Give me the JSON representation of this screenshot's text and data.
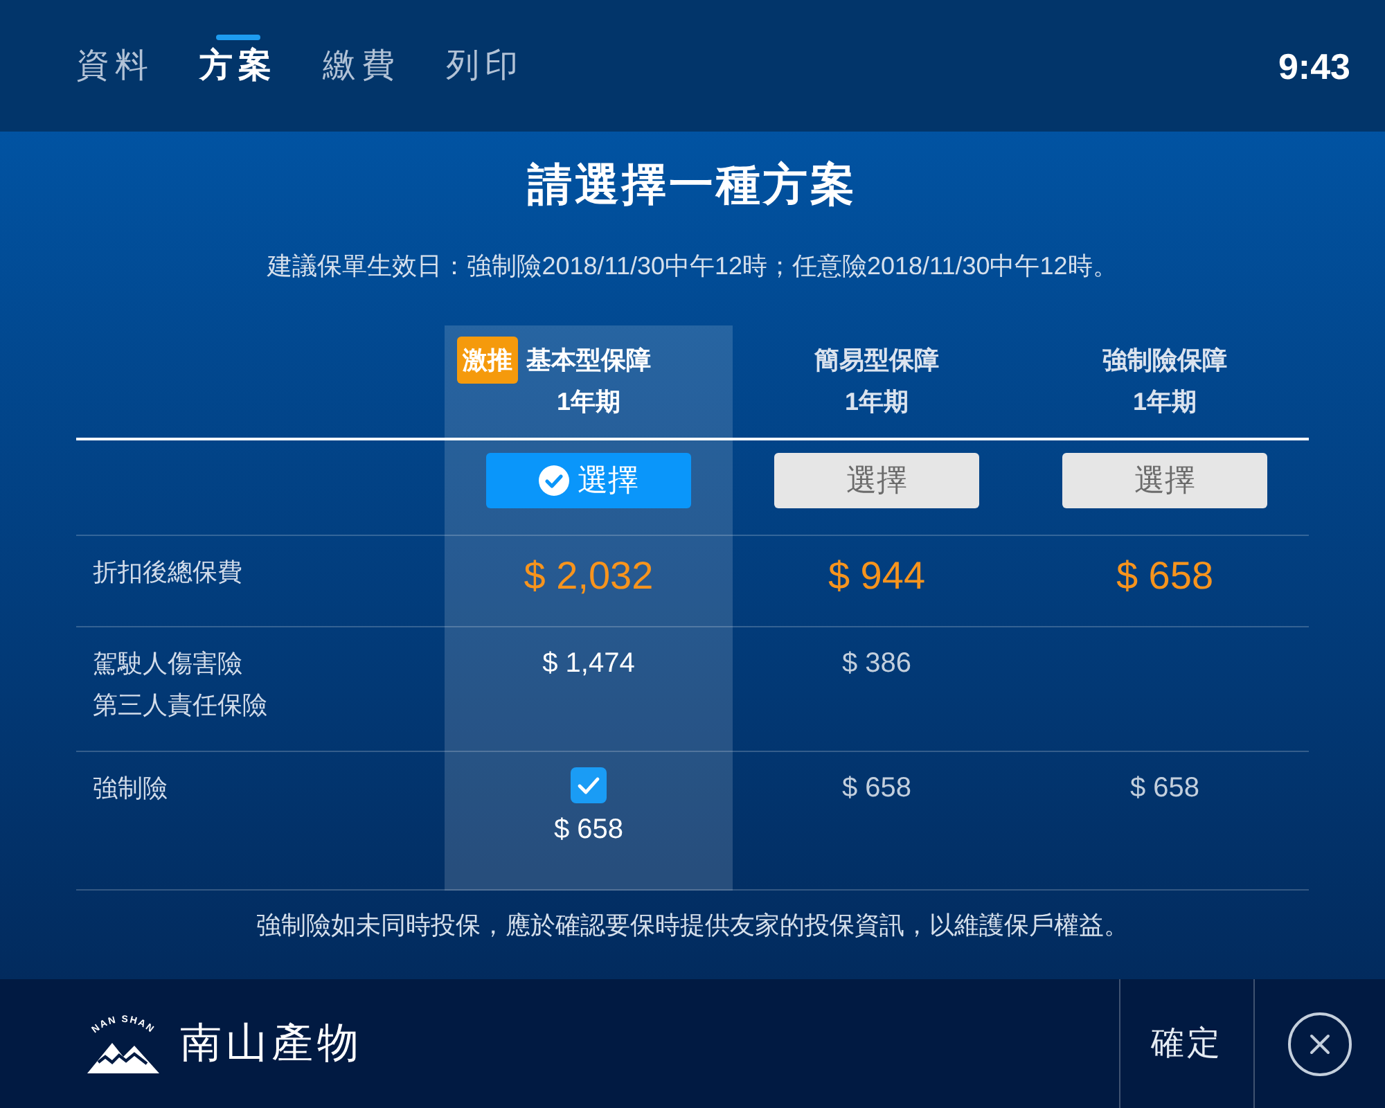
{
  "header": {
    "tabs": [
      {
        "label": "資料",
        "selected": false
      },
      {
        "label": "方案",
        "selected": true
      },
      {
        "label": "繳費",
        "selected": false
      },
      {
        "label": "列印",
        "selected": false
      }
    ],
    "time": "9:43"
  },
  "title": "請選擇一種方案",
  "subtitle": "建議保單生效日：強制險2018/11/30中午12時；任意險2018/11/30中午12時。",
  "plans": [
    {
      "badge": "激推",
      "name": "基本型保障",
      "term": "1年期",
      "selected": true,
      "button": "選擇"
    },
    {
      "name": "簡易型保障",
      "term": "1年期",
      "selected": false,
      "button": "選擇"
    },
    {
      "name": "強制險保障",
      "term": "1年期",
      "selected": false,
      "button": "選擇"
    }
  ],
  "rows": [
    {
      "kind": "total",
      "label_lines": [
        "折扣後總保費"
      ],
      "cells": [
        {
          "kind": "text",
          "value": "$ 2,032"
        },
        {
          "kind": "text",
          "value": "$ 944"
        },
        {
          "kind": "text",
          "value": "$ 658"
        }
      ]
    },
    {
      "kind": "detail",
      "label_lines": [
        "駕駛人傷害險",
        "第三人責任保險"
      ],
      "cells": [
        {
          "kind": "text",
          "value": "$ 1,474"
        },
        {
          "kind": "text",
          "value": "$ 386"
        },
        null
      ]
    },
    {
      "kind": "detail",
      "label_lines": [
        "強制險"
      ],
      "cells": [
        {
          "kind": "checkbox",
          "checked": true,
          "value": "$ 658"
        },
        {
          "kind": "text",
          "value": "$ 658"
        },
        {
          "kind": "text",
          "value": "$ 658"
        }
      ]
    }
  ],
  "note": "強制險如未同時投保，應於確認要保時提供友家的投保資訊，以維護保戶權益。",
  "footer": {
    "logo": {
      "tagline": "NAN SHAN",
      "name": "南山產物"
    },
    "confirm_button": "確定"
  }
}
